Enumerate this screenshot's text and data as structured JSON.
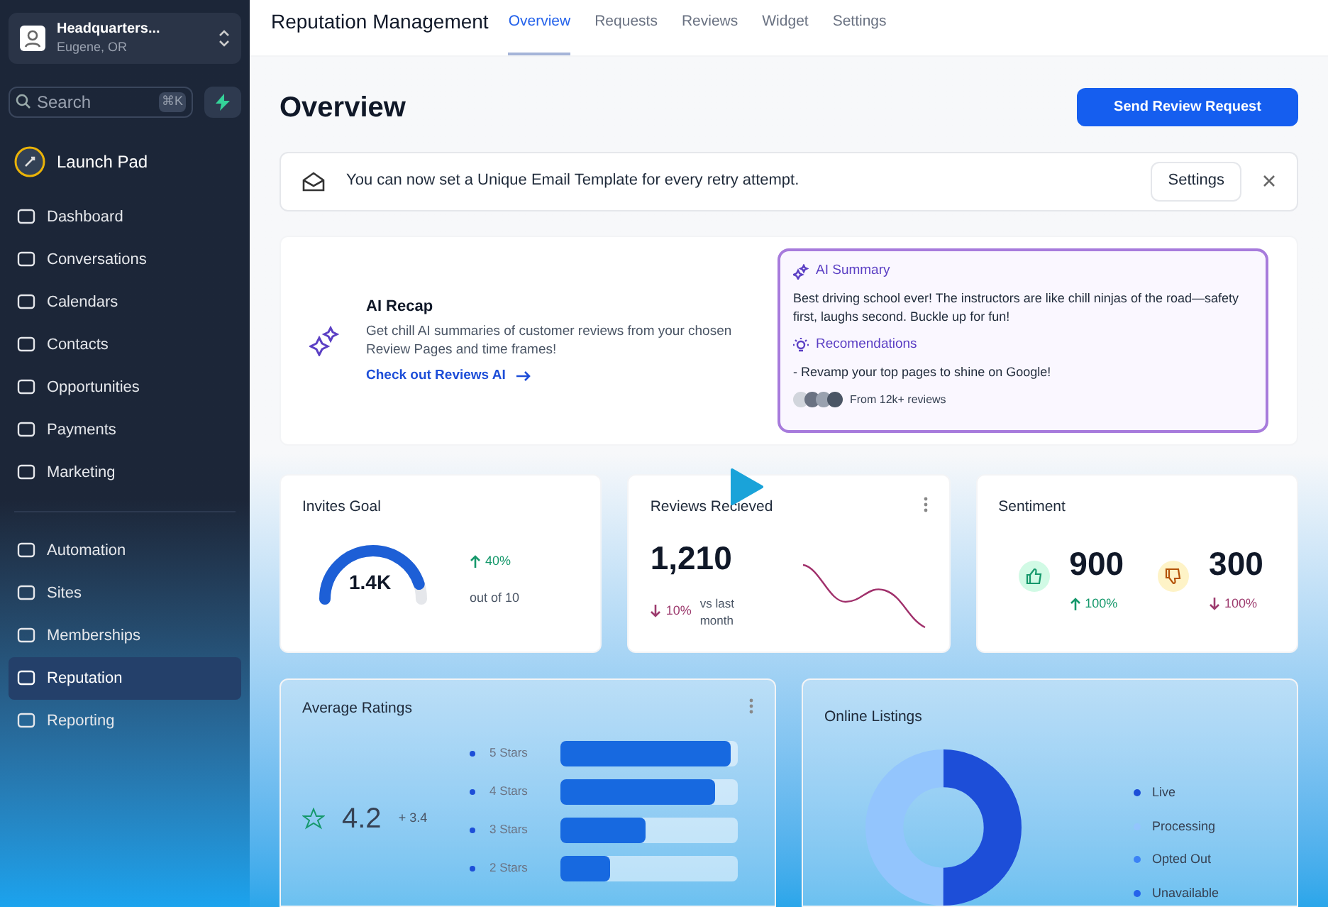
{
  "sidebar": {
    "location": {
      "name": "Headquarters...",
      "sub": "Eugene, OR"
    },
    "search": {
      "placeholder": "Search",
      "shortcut": "⌘K"
    },
    "launch_pad": "Launch Pad",
    "groups": [
      [
        {
          "label": "Dashboard",
          "selected": false
        },
        {
          "label": "Conversations",
          "selected": false
        },
        {
          "label": "Calendars",
          "selected": false
        },
        {
          "label": "Contacts",
          "selected": false
        },
        {
          "label": "Opportunities",
          "selected": false
        },
        {
          "label": "Payments",
          "selected": false
        },
        {
          "label": "Marketing",
          "selected": false
        }
      ],
      [
        {
          "label": "Automation",
          "selected": false
        },
        {
          "label": "Sites",
          "selected": false
        },
        {
          "label": "Memberships",
          "selected": false
        },
        {
          "label": "Reputation",
          "selected": true
        },
        {
          "label": "Reporting",
          "selected": false
        }
      ]
    ]
  },
  "header": {
    "title": "Reputation Management",
    "tabs": [
      {
        "label": "Overview",
        "selected": true
      },
      {
        "label": "Requests",
        "selected": false
      },
      {
        "label": "Reviews",
        "selected": false
      },
      {
        "label": "Widget",
        "selected": false
      },
      {
        "label": "Settings",
        "selected": false
      }
    ]
  },
  "page_title": "Overview",
  "primary_button": "Send  Review Request",
  "banner": {
    "text": "You can now set a Unique Email Template for every retry attempt.",
    "button": "Settings"
  },
  "ai_recap": {
    "title": "AI Recap",
    "text": "Get chill AI summaries of customer reviews from your chosen Review Pages and time frames!",
    "link": "Check out Reviews AI"
  },
  "ai_summary": {
    "title": "AI Summary",
    "text": "Best driving school ever! The instructors are like chill ninjas of the road—safety first, laughs second. Buckle up for fun!",
    "recommendations_title": "Recomendations",
    "recommendation": "- Revamp your top pages to shine on Google!",
    "reviews_note": "From 12k+ reviews"
  },
  "invites_goal": {
    "title": "Invites Goal",
    "value": "1.4K",
    "level": 0.9,
    "change": "40%",
    "note": "out of 10"
  },
  "reviews_received": {
    "title": "Reviews Recieved",
    "value": "1,210",
    "change": "10%",
    "note": "vs last month"
  },
  "sentiment": {
    "title": "Sentiment",
    "positive": {
      "value": "900",
      "change": "100%"
    },
    "negative": {
      "value": "300",
      "change": "100%"
    }
  },
  "average_ratings": {
    "title": "Average Ratings",
    "value": "4.2",
    "change": "+ 3.4",
    "bars": [
      {
        "label": "5 Stars",
        "level": 0.96
      },
      {
        "label": "4 Stars",
        "level": 0.87
      },
      {
        "label": "3 Stars",
        "level": 0.48
      },
      {
        "label": "2 Stars",
        "level": 0.28
      }
    ]
  },
  "online_listings": {
    "title": "Online Listings",
    "legend": [
      {
        "label": "Live",
        "color": "#1d4ed8"
      },
      {
        "label": "Processing",
        "color": "#93c5fd"
      },
      {
        "label": "Opted Out",
        "color": "#3b82f6"
      },
      {
        "label": "Unavailable",
        "color": "#2563eb"
      }
    ]
  }
}
